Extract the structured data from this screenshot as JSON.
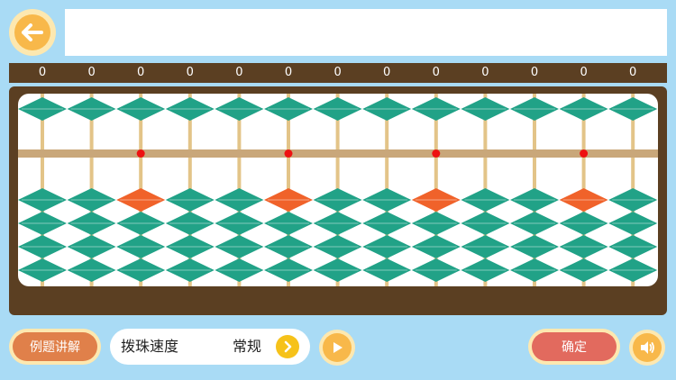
{
  "header": {
    "back_icon": "arrow-left-icon",
    "question_text": ""
  },
  "abacus": {
    "rod_values": [
      "0",
      "0",
      "0",
      "0",
      "0",
      "0",
      "0",
      "0",
      "0",
      "0",
      "0",
      "0",
      "0"
    ],
    "marker_rods": [
      3,
      6,
      9,
      12
    ],
    "colors": {
      "bead": "#21a287",
      "bead_marked": "#f0622a",
      "rod": "#e3c488",
      "beam": "#c9a77a",
      "marker_dot": "#ee1111",
      "frame": "#5b3f22"
    }
  },
  "controls": {
    "example_label": "例题讲解",
    "speed_label": "拨珠速度",
    "speed_value": "常规",
    "speed_next_icon": "chevron-right-icon",
    "play_icon": "play-icon",
    "confirm_label": "确定",
    "sound_icon": "speaker-icon"
  }
}
